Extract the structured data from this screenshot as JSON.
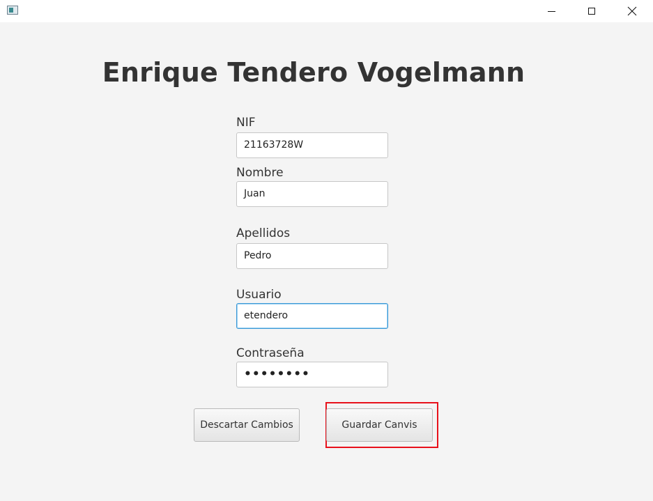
{
  "window": {
    "icon": "app-icon",
    "controls": [
      "minimize-icon",
      "maximize-icon",
      "close-icon"
    ]
  },
  "form": {
    "title": "Enrique Tendero Vogelmann",
    "fields": [
      {
        "label": "NIF",
        "value": "21163728W"
      },
      {
        "label": "Nombre",
        "value": "Juan"
      },
      {
        "label": "Apellidos",
        "value": "Pedro"
      },
      {
        "label": "Usuario",
        "value": "etendero",
        "focused": true
      },
      {
        "label": "Contraseña",
        "value": "••••••••",
        "masked": true
      }
    ]
  },
  "buttons": {
    "discard_label": "Descartar Cambios",
    "save_label": "Guardar Canvis"
  },
  "colors": {
    "background": "#f4f4f4",
    "focus_border": "#3b98d6",
    "highlight": "#e8111b"
  }
}
